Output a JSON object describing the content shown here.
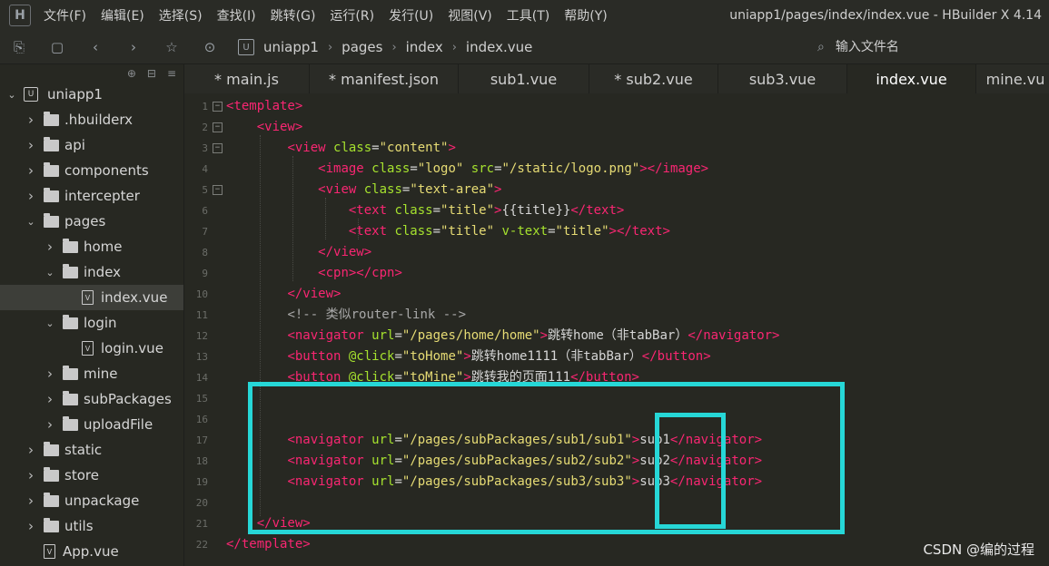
{
  "menubar": {
    "logo": "H",
    "items": [
      "文件(F)",
      "编辑(E)",
      "选择(S)",
      "查找(I)",
      "跳转(G)",
      "运行(R)",
      "发行(U)",
      "视图(V)",
      "工具(T)",
      "帮助(Y)"
    ],
    "window_title": "uniapp1/pages/index/index.vue - HBuilder X 4.14"
  },
  "toolbar": {
    "icons": [
      "new-file-icon",
      "save-icon",
      "back-icon",
      "forward-icon",
      "star-icon",
      "run-icon"
    ],
    "breadcrumb": [
      "uniapp1",
      "pages",
      "index",
      "index.vue"
    ],
    "file_search_placeholder": "输入文件名"
  },
  "sidebar": {
    "tree": [
      {
        "label": "uniapp1",
        "kind": "project",
        "depth": 0,
        "open": true
      },
      {
        "label": ".hbuilderx",
        "kind": "folder",
        "depth": 1,
        "open": false
      },
      {
        "label": "api",
        "kind": "folder",
        "depth": 1,
        "open": false
      },
      {
        "label": "components",
        "kind": "folder",
        "depth": 1,
        "open": false
      },
      {
        "label": "intercepter",
        "kind": "folder",
        "depth": 1,
        "open": false
      },
      {
        "label": "pages",
        "kind": "folder",
        "depth": 1,
        "open": true
      },
      {
        "label": "home",
        "kind": "folder",
        "depth": 2,
        "open": false
      },
      {
        "label": "index",
        "kind": "folder",
        "depth": 2,
        "open": true
      },
      {
        "label": "index.vue",
        "kind": "file",
        "depth": 3,
        "selected": true
      },
      {
        "label": "login",
        "kind": "folder",
        "depth": 2,
        "open": true
      },
      {
        "label": "login.vue",
        "kind": "file",
        "depth": 3
      },
      {
        "label": "mine",
        "kind": "folder",
        "depth": 2,
        "open": false
      },
      {
        "label": "subPackages",
        "kind": "folder",
        "depth": 2,
        "open": false
      },
      {
        "label": "uploadFile",
        "kind": "folder",
        "depth": 2,
        "open": false
      },
      {
        "label": "static",
        "kind": "folder",
        "depth": 1,
        "open": false
      },
      {
        "label": "store",
        "kind": "folder",
        "depth": 1,
        "open": false
      },
      {
        "label": "unpackage",
        "kind": "folder",
        "depth": 1,
        "open": false
      },
      {
        "label": "utils",
        "kind": "folder",
        "depth": 1,
        "open": false
      },
      {
        "label": "App.vue",
        "kind": "file",
        "depth": 1
      }
    ]
  },
  "tabs": [
    {
      "label": "* main.js"
    },
    {
      "label": "* manifest.json"
    },
    {
      "label": "sub1.vue"
    },
    {
      "label": "* sub2.vue"
    },
    {
      "label": "sub3.vue"
    },
    {
      "label": "index.vue",
      "active": true
    },
    {
      "label": "mine.vu"
    }
  ],
  "code_lines": [
    {
      "n": "1",
      "fold": true,
      "t": [
        [
          "tag",
          "<template>"
        ]
      ]
    },
    {
      "n": "2",
      "fold": true,
      "t": [
        [
          "pl",
          "    "
        ],
        [
          "tag",
          "<view>"
        ]
      ]
    },
    {
      "n": "3",
      "fold": true,
      "t": [
        [
          "pl",
          "        "
        ],
        [
          "tag",
          "<view "
        ],
        [
          "attr",
          "class"
        ],
        [
          "pl",
          "="
        ],
        [
          "str",
          "\"content\""
        ],
        [
          "tag",
          ">"
        ]
      ]
    },
    {
      "n": "4",
      "t": [
        [
          "pl",
          "            "
        ],
        [
          "tag",
          "<image "
        ],
        [
          "attr",
          "class"
        ],
        [
          "pl",
          "="
        ],
        [
          "str",
          "\"logo\""
        ],
        [
          "pl",
          " "
        ],
        [
          "attr",
          "src"
        ],
        [
          "pl",
          "="
        ],
        [
          "str",
          "\"/static/logo.png\""
        ],
        [
          "tag",
          "></image>"
        ]
      ]
    },
    {
      "n": "5",
      "fold": true,
      "t": [
        [
          "pl",
          "            "
        ],
        [
          "tag",
          "<view "
        ],
        [
          "attr",
          "class"
        ],
        [
          "pl",
          "="
        ],
        [
          "str",
          "\"text-area\""
        ],
        [
          "tag",
          ">"
        ]
      ]
    },
    {
      "n": "6",
      "t": [
        [
          "pl",
          "                "
        ],
        [
          "tag",
          "<text "
        ],
        [
          "attr",
          "class"
        ],
        [
          "pl",
          "="
        ],
        [
          "str",
          "\"title\""
        ],
        [
          "tag",
          ">"
        ],
        [
          "pl",
          "{{title}}"
        ],
        [
          "tag",
          "</text>"
        ]
      ]
    },
    {
      "n": "7",
      "t": [
        [
          "pl",
          "                "
        ],
        [
          "tag",
          "<text "
        ],
        [
          "attr",
          "class"
        ],
        [
          "pl",
          "="
        ],
        [
          "str",
          "\"title\""
        ],
        [
          "pl",
          " "
        ],
        [
          "attr",
          "v-text"
        ],
        [
          "pl",
          "="
        ],
        [
          "str",
          "\"title\""
        ],
        [
          "tag",
          "></text>"
        ]
      ]
    },
    {
      "n": "8",
      "t": [
        [
          "pl",
          "            "
        ],
        [
          "tag",
          "</view>"
        ]
      ]
    },
    {
      "n": "9",
      "t": [
        [
          "pl",
          "            "
        ],
        [
          "tag",
          "<cpn></cpn>"
        ]
      ]
    },
    {
      "n": "10",
      "t": [
        [
          "pl",
          "        "
        ],
        [
          "tag",
          "</view>"
        ]
      ]
    },
    {
      "n": "11",
      "t": [
        [
          "pl",
          "        "
        ],
        [
          "cmt",
          "<!-- 类似router-link -->"
        ]
      ]
    },
    {
      "n": "12",
      "t": [
        [
          "pl",
          "        "
        ],
        [
          "tag",
          "<navigator "
        ],
        [
          "attr",
          "url"
        ],
        [
          "pl",
          "="
        ],
        [
          "str",
          "\"/pages/home/home\""
        ],
        [
          "tag",
          ">"
        ],
        [
          "pl",
          "跳转home（非tabBar）"
        ],
        [
          "tag",
          "</navigator>"
        ]
      ]
    },
    {
      "n": "13",
      "t": [
        [
          "pl",
          "        "
        ],
        [
          "tag",
          "<button "
        ],
        [
          "attr",
          "@click"
        ],
        [
          "pl",
          "="
        ],
        [
          "str",
          "\"toHome\""
        ],
        [
          "tag",
          ">"
        ],
        [
          "pl",
          "跳转home1111（非tabBar）"
        ],
        [
          "tag",
          "</button>"
        ]
      ]
    },
    {
      "n": "14",
      "t": [
        [
          "pl",
          "        "
        ],
        [
          "tag",
          "<button "
        ],
        [
          "attr",
          "@click"
        ],
        [
          "pl",
          "="
        ],
        [
          "str",
          "\"toMine\""
        ],
        [
          "tag",
          ">"
        ],
        [
          "pl",
          "跳转我的页面111"
        ],
        [
          "tag",
          "</button>"
        ]
      ]
    },
    {
      "n": "15",
      "t": []
    },
    {
      "n": "16",
      "t": []
    },
    {
      "n": "17",
      "t": [
        [
          "pl",
          "        "
        ],
        [
          "tag",
          "<navigator "
        ],
        [
          "attr",
          "url"
        ],
        [
          "pl",
          "="
        ],
        [
          "str",
          "\"/pages/subPackages/sub1/sub1\""
        ],
        [
          "tag",
          ">"
        ],
        [
          "pl",
          "sub1"
        ],
        [
          "tag",
          "</navigator>"
        ]
      ]
    },
    {
      "n": "18",
      "t": [
        [
          "pl",
          "        "
        ],
        [
          "tag",
          "<navigator "
        ],
        [
          "attr",
          "url"
        ],
        [
          "pl",
          "="
        ],
        [
          "str",
          "\"/pages/subPackages/sub2/sub2\""
        ],
        [
          "tag",
          ">"
        ],
        [
          "pl",
          "sub2"
        ],
        [
          "tag",
          "</navigator>"
        ]
      ]
    },
    {
      "n": "19",
      "t": [
        [
          "pl",
          "        "
        ],
        [
          "tag",
          "<navigator "
        ],
        [
          "attr",
          "url"
        ],
        [
          "pl",
          "="
        ],
        [
          "str",
          "\"/pages/subPackages/sub3/sub3\""
        ],
        [
          "tag",
          ">"
        ],
        [
          "pl",
          "sub3"
        ],
        [
          "tag",
          "</navigator>"
        ]
      ]
    },
    {
      "n": "20",
      "t": []
    },
    {
      "n": "21",
      "t": [
        [
          "pl",
          "    "
        ],
        [
          "tag",
          "</view>"
        ]
      ]
    },
    {
      "n": "22",
      "t": [
        [
          "tag",
          "</template>"
        ]
      ]
    }
  ],
  "highlight_color": "#26d7d7",
  "watermark": "CSDN @编的过程"
}
